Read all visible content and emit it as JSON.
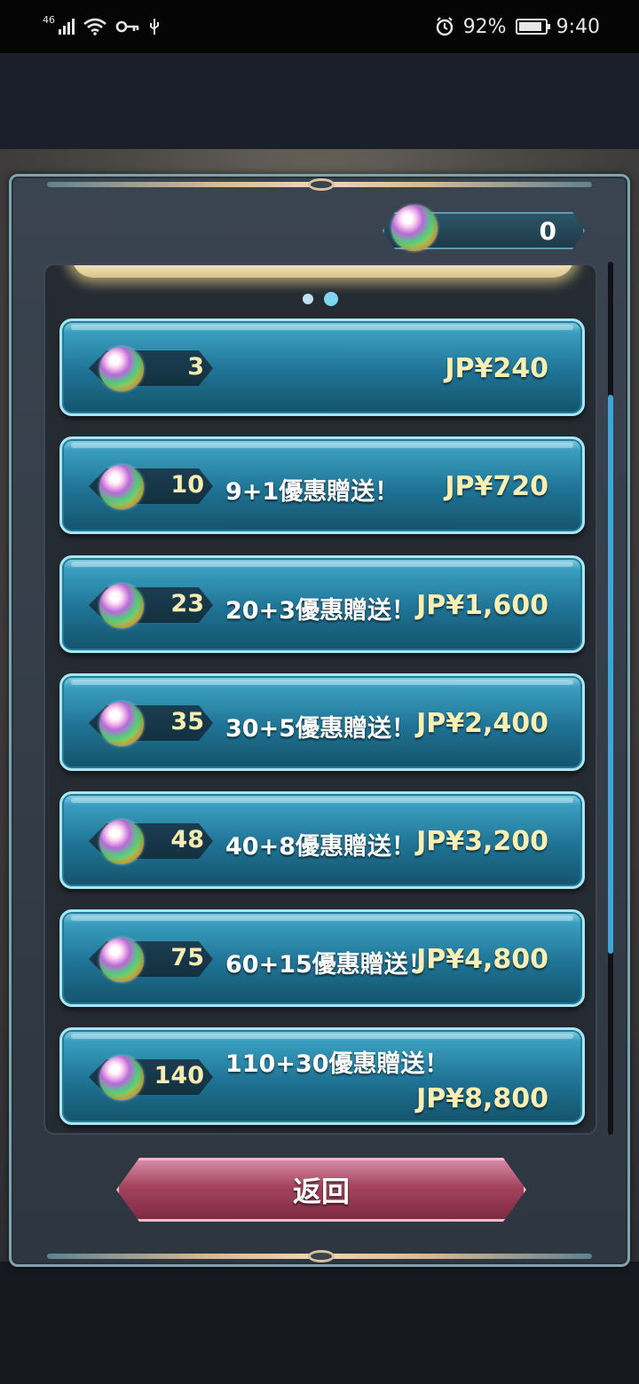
{
  "status_bar": {
    "network": "46",
    "battery": "92%",
    "battery_level": 0.92,
    "time": "9:40"
  },
  "currency": {
    "orbs": "0"
  },
  "carousel": {
    "pages": 2,
    "active_page": 2
  },
  "offers": [
    {
      "quantity": "3",
      "bonus": "",
      "price": "JP¥240"
    },
    {
      "quantity": "10",
      "bonus": "9+1優惠贈送！",
      "price": "JP¥720"
    },
    {
      "quantity": "23",
      "bonus": "20+3優惠贈送！",
      "price": "JP¥1,600"
    },
    {
      "quantity": "35",
      "bonus": "30+5優惠贈送！",
      "price": "JP¥2,400"
    },
    {
      "quantity": "48",
      "bonus": "40+8優惠贈送！",
      "price": "JP¥3,200"
    },
    {
      "quantity": "75",
      "bonus": "60+15優惠贈送！",
      "price": "JP¥4,800"
    },
    {
      "quantity": "140",
      "bonus": "110+30優惠贈送！",
      "price": "JP¥8,800"
    }
  ],
  "back_button": {
    "label": "返回"
  },
  "icons": {
    "status": [
      "signal-icon",
      "wifi-icon",
      "key-icon",
      "usb-icon",
      "alarm-icon",
      "battery-icon"
    ],
    "orb": "orb-icon"
  },
  "colors": {
    "offer_button": "#1f7394",
    "price_text": "#f8efb4",
    "quantity_text": "#f6ebb0",
    "back_button": "#a4445f",
    "scroll_thumb": "#3da8d8"
  }
}
